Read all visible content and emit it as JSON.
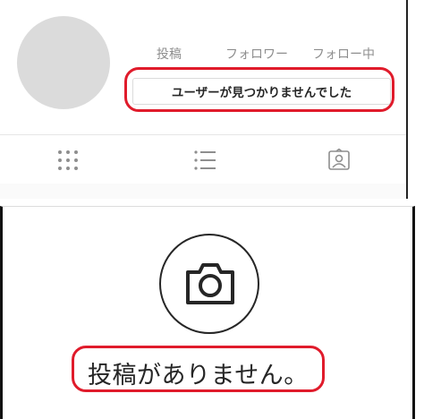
{
  "profile": {
    "stats": {
      "posts_label": "投稿",
      "followers_label": "フォロワー",
      "following_label": "フォロー中"
    },
    "status_message": "ユーザーが見つかりませんでした"
  },
  "tabs": [
    {
      "icon": "grid-icon"
    },
    {
      "icon": "list-icon"
    },
    {
      "icon": "tagged-person-icon"
    }
  ],
  "empty_state": {
    "icon": "camera-icon",
    "message": "投稿がありません。"
  },
  "colors": {
    "highlight_ring": "#e01b2b",
    "avatar_placeholder": "#dbdbdb",
    "muted_text": "#8e8e8e",
    "icon_gray": "#8e8e8e"
  }
}
